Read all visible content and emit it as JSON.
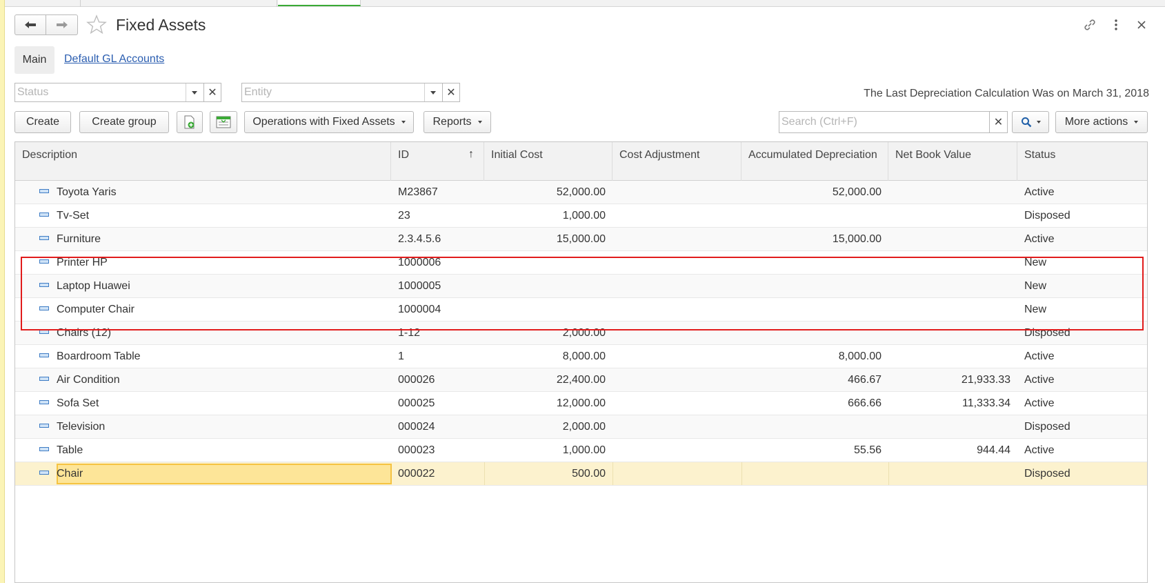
{
  "window": {
    "title": "Fixed Assets"
  },
  "tabs": {
    "main": "Main",
    "gl_accounts": "Default GL Accounts"
  },
  "filters": {
    "status_placeholder": "Status",
    "entity_placeholder": "Entity",
    "last_calc_note": "The Last Depreciation Calculation Was on March 31, 2018"
  },
  "toolbar": {
    "create": "Create",
    "create_group": "Create group",
    "operations": "Operations with Fixed Assets",
    "reports": "Reports",
    "search_placeholder": "Search (Ctrl+F)",
    "more_actions": "More actions"
  },
  "table": {
    "columns": [
      "Description",
      "ID",
      "Initial Cost",
      "Cost Adjustment",
      "Accumulated Depreciation",
      "Net Book Value",
      "Status"
    ],
    "sort_indicator": "↑",
    "rows": [
      {
        "description": "Toyota Yaris",
        "id": "M23867",
        "initial_cost": "52,000.00",
        "cost_adjustment": "",
        "accumulated_depreciation": "52,000.00",
        "net_book_value": "",
        "status": "Active"
      },
      {
        "description": "Tv-Set",
        "id": "23",
        "initial_cost": "1,000.00",
        "cost_adjustment": "",
        "accumulated_depreciation": "",
        "net_book_value": "",
        "status": "Disposed"
      },
      {
        "description": "Furniture",
        "id": "2.3.4.5.6",
        "initial_cost": "15,000.00",
        "cost_adjustment": "",
        "accumulated_depreciation": "15,000.00",
        "net_book_value": "",
        "status": "Active"
      },
      {
        "description": "Printer HP",
        "id": "1000006",
        "initial_cost": "",
        "cost_adjustment": "",
        "accumulated_depreciation": "",
        "net_book_value": "",
        "status": "New"
      },
      {
        "description": "Laptop Huawei",
        "id": "1000005",
        "initial_cost": "",
        "cost_adjustment": "",
        "accumulated_depreciation": "",
        "net_book_value": "",
        "status": "New"
      },
      {
        "description": "Computer Chair",
        "id": "1000004",
        "initial_cost": "",
        "cost_adjustment": "",
        "accumulated_depreciation": "",
        "net_book_value": "",
        "status": "New"
      },
      {
        "description": "Chairs (12)",
        "id": "1-12",
        "initial_cost": "2,000.00",
        "cost_adjustment": "",
        "accumulated_depreciation": "",
        "net_book_value": "",
        "status": "Disposed"
      },
      {
        "description": "Boardroom Table",
        "id": "1",
        "initial_cost": "8,000.00",
        "cost_adjustment": "",
        "accumulated_depreciation": "8,000.00",
        "net_book_value": "",
        "status": "Active"
      },
      {
        "description": "Air Condition",
        "id": "000026",
        "initial_cost": "22,400.00",
        "cost_adjustment": "",
        "accumulated_depreciation": "466.67",
        "net_book_value": "21,933.33",
        "status": "Active"
      },
      {
        "description": "Sofa Set",
        "id": "000025",
        "initial_cost": "12,000.00",
        "cost_adjustment": "",
        "accumulated_depreciation": "666.66",
        "net_book_value": "11,333.34",
        "status": "Active"
      },
      {
        "description": "Television",
        "id": "000024",
        "initial_cost": "2,000.00",
        "cost_adjustment": "",
        "accumulated_depreciation": "",
        "net_book_value": "",
        "status": "Disposed"
      },
      {
        "description": "Table",
        "id": "000023",
        "initial_cost": "1,000.00",
        "cost_adjustment": "",
        "accumulated_depreciation": "55.56",
        "net_book_value": "944.44",
        "status": "Active"
      },
      {
        "description": "Chair",
        "id": "000022",
        "initial_cost": "500.00",
        "cost_adjustment": "",
        "accumulated_depreciation": "",
        "net_book_value": "",
        "status": "Disposed",
        "selected": true
      }
    ]
  },
  "colors": {
    "accent_link": "#2a5db0",
    "selection": "#fde598",
    "highlight_outline": "#e11b1b"
  },
  "icons": [
    "back-arrow-icon",
    "forward-arrow-icon",
    "star-icon",
    "link-icon",
    "kebab-menu-icon",
    "close-icon",
    "create-with-copy-icon",
    "form-list-icon",
    "search-icon",
    "row-item-icon"
  ]
}
